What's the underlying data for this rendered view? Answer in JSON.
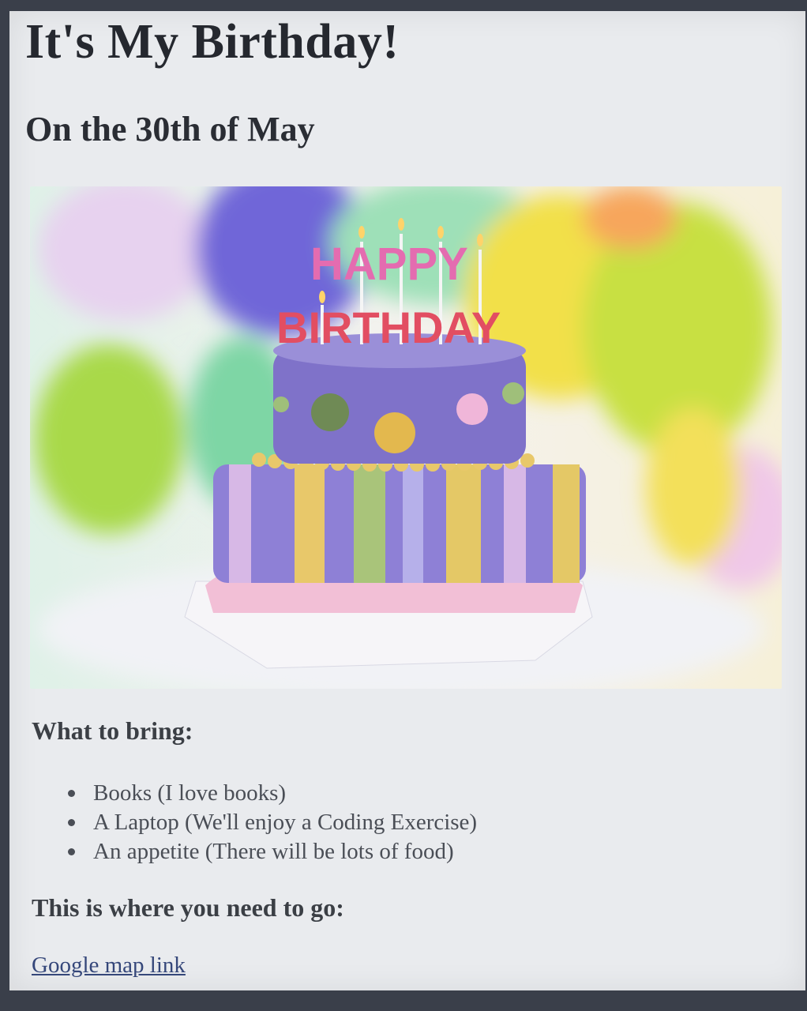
{
  "page": {
    "title": "It's My Birthday!",
    "subtitle": "On the 30th of May"
  },
  "image": {
    "cake_lettering_top": "HAPPY",
    "cake_lettering_bottom": "BIRTHDAY"
  },
  "bring": {
    "heading": "What to bring:",
    "items": [
      "Books (I love books)",
      "A Laptop (We'll enjoy a Coding Exercise)",
      "An appetite (There will be lots of food)"
    ]
  },
  "directions": {
    "heading": "This is where you need to go:",
    "link_label": "Google map link"
  },
  "colors": {
    "background": "#e9ebee",
    "text": "#25282f",
    "link": "#35477a",
    "cake_purple": "#8478c8"
  }
}
